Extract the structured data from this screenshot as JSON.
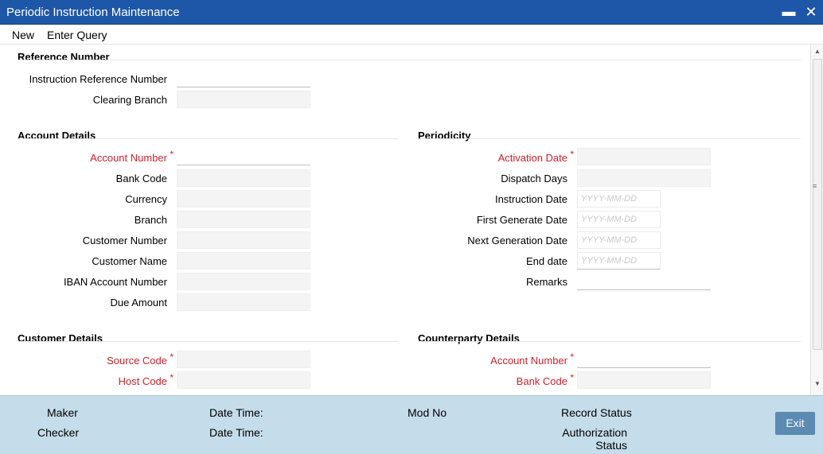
{
  "window": {
    "title": "Periodic Instruction Maintenance",
    "minimize_glyph": "▬",
    "close_glyph": "✕"
  },
  "menu": {
    "new": "New",
    "enter_query": "Enter Query"
  },
  "sections": {
    "reference": "Reference Number",
    "account": "Account Details",
    "periodicity": "Periodicity",
    "customer": "Customer Details",
    "counterparty": "Counterparty Details"
  },
  "reference": {
    "instruction_ref": "Instruction Reference Number",
    "clearing_branch": "Clearing Branch"
  },
  "account": {
    "account_number": "Account Number",
    "bank_code": "Bank Code",
    "currency": "Currency",
    "branch": "Branch",
    "customer_number": "Customer Number",
    "customer_name": "Customer Name",
    "iban": "IBAN Account Number",
    "due_amount": "Due Amount"
  },
  "periodicity": {
    "activation_date": "Activation Date",
    "dispatch_days": "Dispatch Days",
    "instruction_date": "Instruction Date",
    "first_generate_date": "First Generate Date",
    "next_generation_date": "Next Generation Date",
    "end_date": "End date",
    "remarks": "Remarks",
    "date_placeholder": "YYYY-MM-DD"
  },
  "customer": {
    "source_code": "Source Code",
    "host_code": "Host Code"
  },
  "counterparty": {
    "account_number": "Account Number",
    "bank_code": "Bank Code"
  },
  "required_mark": "*",
  "footer": {
    "maker": "Maker",
    "checker": "Checker",
    "date_time_1": "Date Time:",
    "date_time_2": "Date Time:",
    "mod_no": "Mod No",
    "record_status": "Record Status",
    "authorization_status": "Authorization\nStatus",
    "exit": "Exit"
  },
  "colors": {
    "titlebar": "#1f57a8",
    "required": "#d4202a",
    "footer": "#c5dcea",
    "exit_button": "#5b8ab3"
  }
}
